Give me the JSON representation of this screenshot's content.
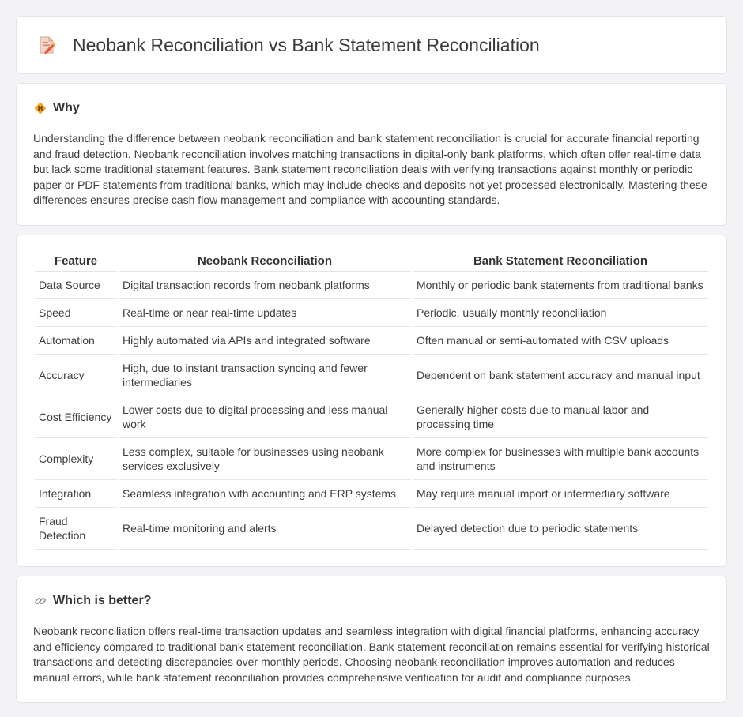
{
  "header": {
    "title": "Neobank Reconciliation vs Bank Statement Reconciliation",
    "icon": "document-edit-icon"
  },
  "why": {
    "heading": "Why",
    "icon": "diamond-warning-icon",
    "text": "Understanding the difference between neobank reconciliation and bank statement reconciliation is crucial for accurate financial reporting and fraud detection. Neobank reconciliation involves matching transactions in digital-only bank platforms, which often offer real-time data but lack some traditional statement features. Bank statement reconciliation deals with verifying transactions against monthly or periodic paper or PDF statements from traditional banks, which may include checks and deposits not yet processed electronically. Mastering these differences ensures precise cash flow management and compliance with accounting standards."
  },
  "table": {
    "headers": [
      "Feature",
      "Neobank Reconciliation",
      "Bank Statement Reconciliation"
    ],
    "rows": [
      [
        "Data Source",
        "Digital transaction records from neobank platforms",
        "Monthly or periodic bank statements from traditional banks"
      ],
      [
        "Speed",
        "Real-time or near real-time updates",
        "Periodic, usually monthly reconciliation"
      ],
      [
        "Automation",
        "Highly automated via APIs and integrated software",
        "Often manual or semi-automated with CSV uploads"
      ],
      [
        "Accuracy",
        "High, due to instant transaction syncing and fewer intermediaries",
        "Dependent on bank statement accuracy and manual input"
      ],
      [
        "Cost Efficiency",
        "Lower costs due to digital processing and less manual work",
        "Generally higher costs due to manual labor and processing time"
      ],
      [
        "Complexity",
        "Less complex, suitable for businesses using neobank services exclusively",
        "More complex for businesses with multiple bank accounts and instruments"
      ],
      [
        "Integration",
        "Seamless integration with accounting and ERP systems",
        "May require manual import or intermediary software"
      ],
      [
        "Fraud Detection",
        "Real-time monitoring and alerts",
        "Delayed detection due to periodic statements"
      ]
    ]
  },
  "better": {
    "heading": "Which is better?",
    "icon": "link-icon",
    "text": "Neobank reconciliation offers real-time transaction updates and seamless integration with digital financial platforms, enhancing accuracy and efficiency compared to traditional bank statement reconciliation. Bank statement reconciliation remains essential for verifying historical transactions and detecting discrepancies over monthly periods. Choosing neobank reconciliation improves automation and reduces manual errors, while bank statement reconciliation provides comprehensive verification for audit and compliance purposes."
  }
}
